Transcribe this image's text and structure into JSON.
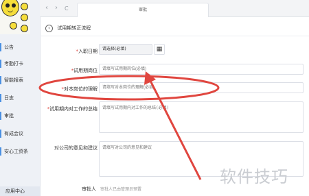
{
  "sidebar": {
    "items": [
      {
        "label": "公告"
      },
      {
        "label": "考勤打卡"
      },
      {
        "label": "智能报表"
      },
      {
        "label": "日志"
      },
      {
        "label": "审批"
      },
      {
        "label": "有成会议"
      },
      {
        "label": "安心工资条"
      }
    ],
    "bottom_label": "应用中心"
  },
  "browser": {
    "tab_title": "审批",
    "back": "‹",
    "forward": "›",
    "reload": "C"
  },
  "page": {
    "title": "试用期转正流程",
    "watermark": "软件技巧"
  },
  "form": {
    "entry_date": {
      "label": "入职日期",
      "value": "请选择(必填)"
    },
    "position": {
      "label": "试用期岗位",
      "placeholder": "请填写试用期岗位(必填)"
    },
    "understanding": {
      "label": "对本岗位的理解",
      "placeholder": "请填写对本岗位的理解(必填)"
    },
    "summary": {
      "label": "试用期内对工作的总结",
      "placeholder": "请填写试用期内对工作的总结(必填)"
    },
    "suggestion": {
      "label": "对公司的意见和建议",
      "placeholder": "请填写对公司的意见和建议"
    },
    "approver": {
      "label": "审批人",
      "value": "审批人已由管理员预置"
    }
  },
  "annotation": {
    "ellipse_color": "#e0463f",
    "arrow_color": "#e0463f"
  }
}
